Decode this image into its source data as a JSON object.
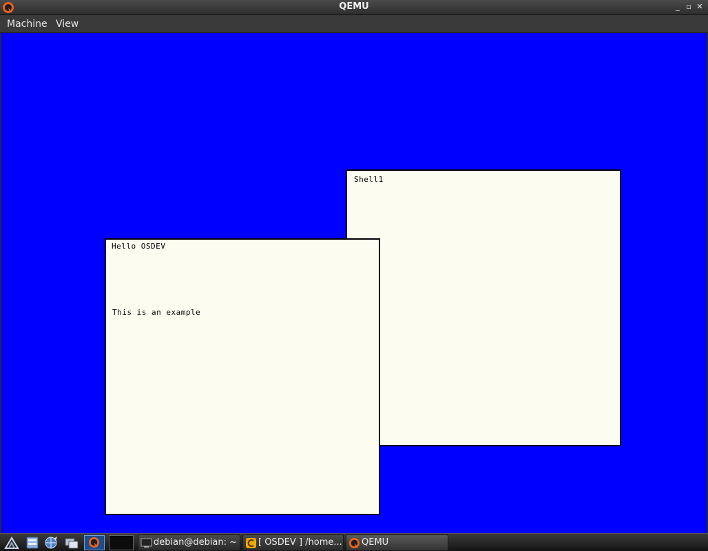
{
  "window": {
    "title": "QEMU",
    "controls": {
      "minimize": "_",
      "maximize": "▫",
      "close": "✕"
    }
  },
  "menubar": {
    "items": [
      "Machine",
      "View"
    ]
  },
  "guest": {
    "background": "#0000ff",
    "windows": {
      "shell": {
        "title": "Shell1"
      },
      "hello": {
        "title": "Hello OSDEV",
        "body": "This is an example"
      }
    }
  },
  "taskbar": {
    "tasks": [
      {
        "label": "debian@debian: ~",
        "icon": "terminal-icon"
      },
      {
        "label": "[ OSDEV ] /home...",
        "icon": "editor-c-icon"
      },
      {
        "label": "QEMU",
        "icon": "qemu-icon"
      }
    ]
  },
  "colors": {
    "guest_blue": "#0000ff",
    "guest_window_bg": "#fcfcf0",
    "qemu_orange": "#e8641b"
  }
}
